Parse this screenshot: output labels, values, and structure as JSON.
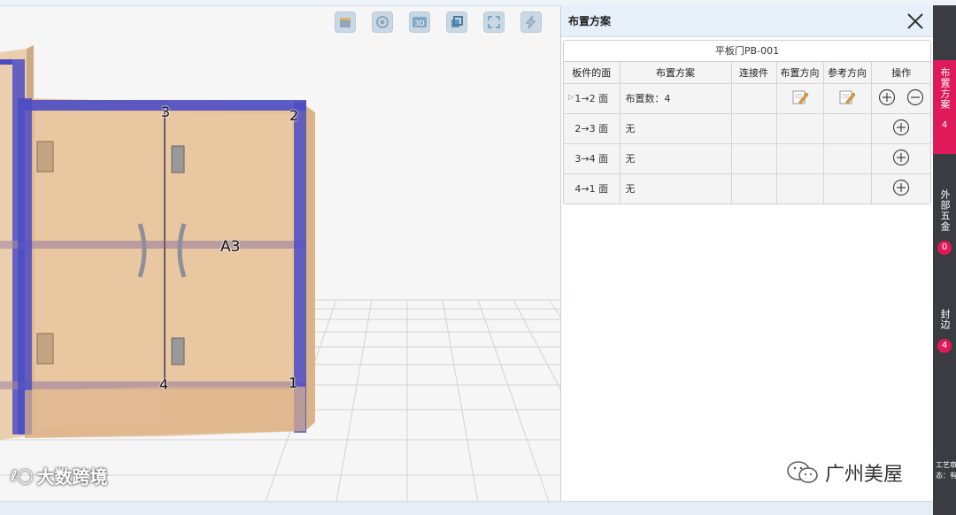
{
  "viewport": {
    "toolbar": [
      "cabinet-icon",
      "target-icon",
      "3d-view-icon",
      "layers-icon",
      "fit-screen-icon",
      "lightning-icon"
    ],
    "labels": {
      "corner3": "3",
      "corner2": "2",
      "corner4": "4",
      "corner1": "1",
      "panel_id": "A3"
    },
    "watermark": "大数跨境"
  },
  "panel": {
    "title": "布置方案",
    "caption": "平板门PB-001",
    "columns": [
      "板件的面",
      "布置方案",
      "连接件",
      "布置方向",
      "参考方向",
      "操作"
    ],
    "rows": [
      {
        "face": "1→2 面",
        "scheme": "布置数：4",
        "connector": "",
        "has_edit": true,
        "ops": [
          "add",
          "remove"
        ]
      },
      {
        "face": "2→3 面",
        "scheme": "无",
        "connector": "",
        "has_edit": false,
        "ops": [
          "add"
        ]
      },
      {
        "face": "3→4 面",
        "scheme": "无",
        "connector": "",
        "has_edit": false,
        "ops": [
          "add"
        ]
      },
      {
        "face": "4→1 面",
        "scheme": "无",
        "connector": "",
        "has_edit": false,
        "ops": [
          "add"
        ]
      }
    ]
  },
  "sidebar": {
    "tabs": [
      {
        "label": "布置方案",
        "count": "4",
        "active": true
      },
      {
        "label": "外部五金",
        "count": "0",
        "active": false
      },
      {
        "label": "封边",
        "count": "4",
        "active": false
      }
    ],
    "footer": "工艺审核状态：有改动"
  },
  "watermark_right": "广州美屋",
  "colors": {
    "accent": "#e0195a",
    "sidebar_bg": "#3a3c42",
    "edge_blue": "#4b4cc4"
  }
}
